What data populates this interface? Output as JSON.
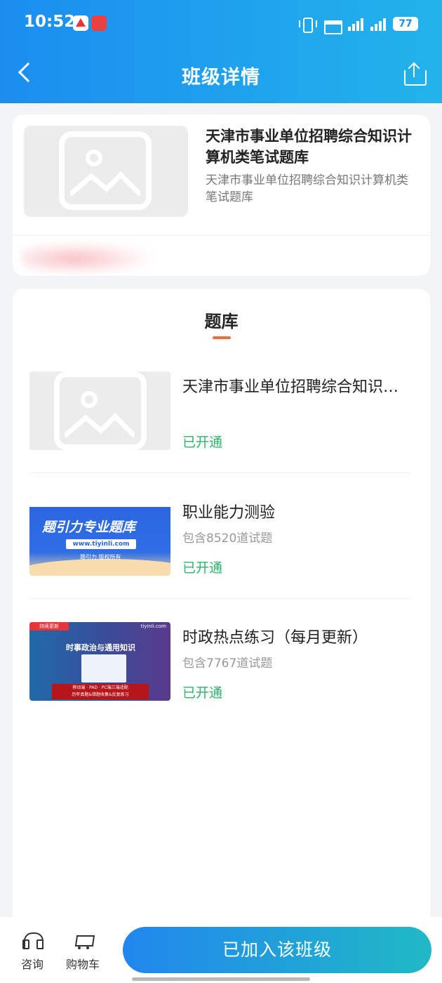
{
  "status_bar": {
    "time": "10:52",
    "battery": "77",
    "net1": "4G",
    "net2": "4G"
  },
  "nav": {
    "title": "班级详情"
  },
  "class_card": {
    "title": "天津市事业单位招聘综合知识计算机类笔试题库",
    "subtitle": "天津市事业单位招聘综合知识计算机类笔试题库"
  },
  "section": {
    "title": "题库"
  },
  "items": [
    {
      "title": "天津市事业单位招聘综合知识计算机类笔试题库",
      "count": "",
      "status": "已开通"
    },
    {
      "title": "职业能力测验",
      "count": "包含8520道试题",
      "status": "已开通",
      "thumb": {
        "headline": "题引力专业题库",
        "url": "www.tiyinli.com",
        "owner": "题引力 版权所有"
      }
    },
    {
      "title": "时政热点练习（每月更新）",
      "count": "包含7767道试题",
      "status": "已开通",
      "thumb": {
        "tag": "持续更新",
        "headline": "时事政治与通用知识",
        "site": "tiyinli.com",
        "band_line1": "移动端 · PAD · PC端三端适配",
        "band_line2": "历年真题&错题收集&反复练习"
      }
    }
  ],
  "bottom": {
    "consult": "咨询",
    "cart": "购物车",
    "join": "已加入该班级"
  },
  "colors": {
    "header_start": "#1b8df0",
    "header_end": "#22b3ea",
    "status_green": "#2db36b",
    "tab_accent": "#ee6b3b"
  }
}
